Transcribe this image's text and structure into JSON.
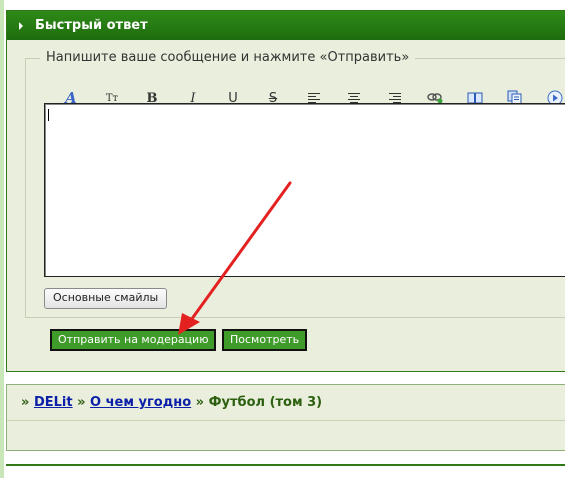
{
  "quick_reply": {
    "title": "Быстрый ответ",
    "legend": "Напишите ваше сообщение и нажмите «Отправить»",
    "toolbar": [
      {
        "name": "font-icon",
        "glyph": "A"
      },
      {
        "name": "font-size-icon",
        "glyph": "Tт"
      },
      {
        "name": "bold-icon",
        "glyph": "B"
      },
      {
        "name": "italic-icon",
        "glyph": "I"
      },
      {
        "name": "underline-icon",
        "glyph": "U"
      },
      {
        "name": "strikethrough-icon",
        "glyph": "S"
      },
      {
        "name": "align-left-icon",
        "glyph": ""
      },
      {
        "name": "align-center-icon",
        "glyph": ""
      },
      {
        "name": "align-right-icon",
        "glyph": ""
      },
      {
        "name": "insert-link-icon",
        "glyph": ""
      },
      {
        "name": "book-icon",
        "glyph": ""
      },
      {
        "name": "copy-icon",
        "glyph": ""
      },
      {
        "name": "play-circle-icon",
        "glyph": ""
      }
    ],
    "message_value": "",
    "smiles_button": "Основные смайлы",
    "submit_button": "Отправить на модерацию",
    "preview_button": "Посмотреть"
  },
  "breadcrumb": {
    "sep": "»",
    "items": [
      "DELit",
      "О чем угодно"
    ],
    "current": "Футбол (том 3)"
  },
  "colors": {
    "header_green": "#1e6c0d",
    "panel_bg": "#e9efdc",
    "button_green": "#3f9c2a",
    "link_blue": "#0b1fa8",
    "annotation_red": "#e32121"
  }
}
